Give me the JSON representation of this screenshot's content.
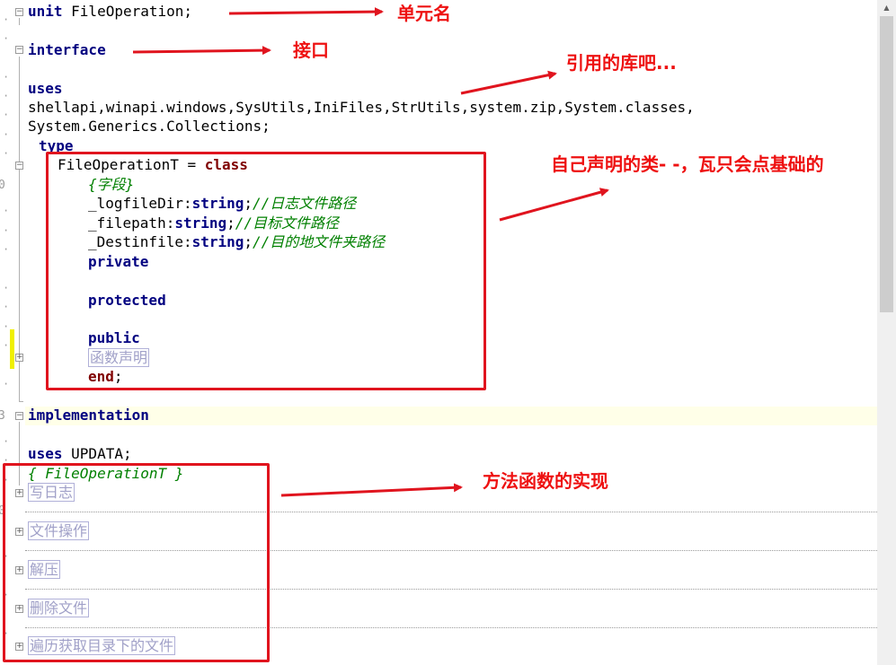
{
  "gutter": {
    "markers": [
      "0",
      "3",
      "0"
    ]
  },
  "code": {
    "unit_kw": "unit",
    "unit_name": " FileOperation;",
    "interface_kw": "interface",
    "uses_kw": "uses",
    "uses_list_1": "shellapi,winapi.windows,SysUtils,IniFiles,StrUtils,system.zip,System.classes,",
    "uses_list_2": "System.Generics.Collections;",
    "type_kw": "type",
    "class_decl": "FileOperationT = ",
    "class_kw": "class",
    "fields_comment": "{字段}",
    "field1_name": "_logfileDir:",
    "field1_type": "string",
    "field1_comment": "//日志文件路径",
    "field2_name": "_filepath:",
    "field2_type": "string",
    "field2_comment": "//目标文件路径",
    "field3_name": "_Destinfile:",
    "field3_type": "string",
    "field3_comment": "//目的地文件夹路径",
    "private_kw": "private",
    "protected_kw": "protected",
    "public_kw": "public",
    "methods_region": "函数声明",
    "end_kw": "end",
    "end_semicolon": ";",
    "implementation_kw": "implementation",
    "uses2_list": " UPDATA;",
    "impl_comment": "{ FileOperationT }",
    "regions": [
      "写日志",
      "文件操作",
      "解压",
      "删除文件",
      "遍历获取目录下的文件"
    ]
  },
  "annotations": {
    "unit_name": "单元名",
    "interface": "接口",
    "uses": "引用的库吧...",
    "class": "自己声明的类- -，瓦只会点基础的",
    "methods": "方法函数的实现"
  },
  "colors": {
    "annotation": "#ee1111",
    "keyword": "#000080",
    "comment": "#008000",
    "class_keyword": "#800000"
  }
}
